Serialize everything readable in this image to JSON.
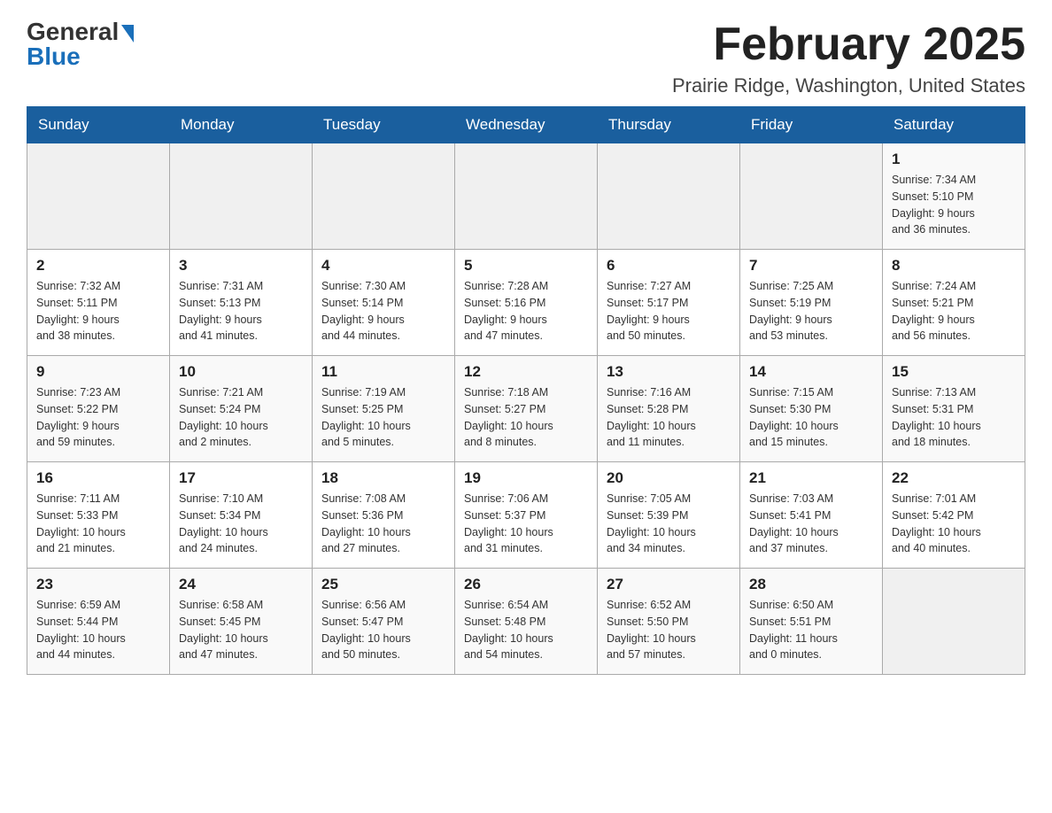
{
  "logo": {
    "general": "General",
    "blue": "Blue"
  },
  "title": "February 2025",
  "subtitle": "Prairie Ridge, Washington, United States",
  "days_of_week": [
    "Sunday",
    "Monday",
    "Tuesday",
    "Wednesday",
    "Thursday",
    "Friday",
    "Saturday"
  ],
  "weeks": [
    [
      {
        "day": "",
        "info": ""
      },
      {
        "day": "",
        "info": ""
      },
      {
        "day": "",
        "info": ""
      },
      {
        "day": "",
        "info": ""
      },
      {
        "day": "",
        "info": ""
      },
      {
        "day": "",
        "info": ""
      },
      {
        "day": "1",
        "info": "Sunrise: 7:34 AM\nSunset: 5:10 PM\nDaylight: 9 hours\nand 36 minutes."
      }
    ],
    [
      {
        "day": "2",
        "info": "Sunrise: 7:32 AM\nSunset: 5:11 PM\nDaylight: 9 hours\nand 38 minutes."
      },
      {
        "day": "3",
        "info": "Sunrise: 7:31 AM\nSunset: 5:13 PM\nDaylight: 9 hours\nand 41 minutes."
      },
      {
        "day": "4",
        "info": "Sunrise: 7:30 AM\nSunset: 5:14 PM\nDaylight: 9 hours\nand 44 minutes."
      },
      {
        "day": "5",
        "info": "Sunrise: 7:28 AM\nSunset: 5:16 PM\nDaylight: 9 hours\nand 47 minutes."
      },
      {
        "day": "6",
        "info": "Sunrise: 7:27 AM\nSunset: 5:17 PM\nDaylight: 9 hours\nand 50 minutes."
      },
      {
        "day": "7",
        "info": "Sunrise: 7:25 AM\nSunset: 5:19 PM\nDaylight: 9 hours\nand 53 minutes."
      },
      {
        "day": "8",
        "info": "Sunrise: 7:24 AM\nSunset: 5:21 PM\nDaylight: 9 hours\nand 56 minutes."
      }
    ],
    [
      {
        "day": "9",
        "info": "Sunrise: 7:23 AM\nSunset: 5:22 PM\nDaylight: 9 hours\nand 59 minutes."
      },
      {
        "day": "10",
        "info": "Sunrise: 7:21 AM\nSunset: 5:24 PM\nDaylight: 10 hours\nand 2 minutes."
      },
      {
        "day": "11",
        "info": "Sunrise: 7:19 AM\nSunset: 5:25 PM\nDaylight: 10 hours\nand 5 minutes."
      },
      {
        "day": "12",
        "info": "Sunrise: 7:18 AM\nSunset: 5:27 PM\nDaylight: 10 hours\nand 8 minutes."
      },
      {
        "day": "13",
        "info": "Sunrise: 7:16 AM\nSunset: 5:28 PM\nDaylight: 10 hours\nand 11 minutes."
      },
      {
        "day": "14",
        "info": "Sunrise: 7:15 AM\nSunset: 5:30 PM\nDaylight: 10 hours\nand 15 minutes."
      },
      {
        "day": "15",
        "info": "Sunrise: 7:13 AM\nSunset: 5:31 PM\nDaylight: 10 hours\nand 18 minutes."
      }
    ],
    [
      {
        "day": "16",
        "info": "Sunrise: 7:11 AM\nSunset: 5:33 PM\nDaylight: 10 hours\nand 21 minutes."
      },
      {
        "day": "17",
        "info": "Sunrise: 7:10 AM\nSunset: 5:34 PM\nDaylight: 10 hours\nand 24 minutes."
      },
      {
        "day": "18",
        "info": "Sunrise: 7:08 AM\nSunset: 5:36 PM\nDaylight: 10 hours\nand 27 minutes."
      },
      {
        "day": "19",
        "info": "Sunrise: 7:06 AM\nSunset: 5:37 PM\nDaylight: 10 hours\nand 31 minutes."
      },
      {
        "day": "20",
        "info": "Sunrise: 7:05 AM\nSunset: 5:39 PM\nDaylight: 10 hours\nand 34 minutes."
      },
      {
        "day": "21",
        "info": "Sunrise: 7:03 AM\nSunset: 5:41 PM\nDaylight: 10 hours\nand 37 minutes."
      },
      {
        "day": "22",
        "info": "Sunrise: 7:01 AM\nSunset: 5:42 PM\nDaylight: 10 hours\nand 40 minutes."
      }
    ],
    [
      {
        "day": "23",
        "info": "Sunrise: 6:59 AM\nSunset: 5:44 PM\nDaylight: 10 hours\nand 44 minutes."
      },
      {
        "day": "24",
        "info": "Sunrise: 6:58 AM\nSunset: 5:45 PM\nDaylight: 10 hours\nand 47 minutes."
      },
      {
        "day": "25",
        "info": "Sunrise: 6:56 AM\nSunset: 5:47 PM\nDaylight: 10 hours\nand 50 minutes."
      },
      {
        "day": "26",
        "info": "Sunrise: 6:54 AM\nSunset: 5:48 PM\nDaylight: 10 hours\nand 54 minutes."
      },
      {
        "day": "27",
        "info": "Sunrise: 6:52 AM\nSunset: 5:50 PM\nDaylight: 10 hours\nand 57 minutes."
      },
      {
        "day": "28",
        "info": "Sunrise: 6:50 AM\nSunset: 5:51 PM\nDaylight: 11 hours\nand 0 minutes."
      },
      {
        "day": "",
        "info": ""
      }
    ]
  ]
}
